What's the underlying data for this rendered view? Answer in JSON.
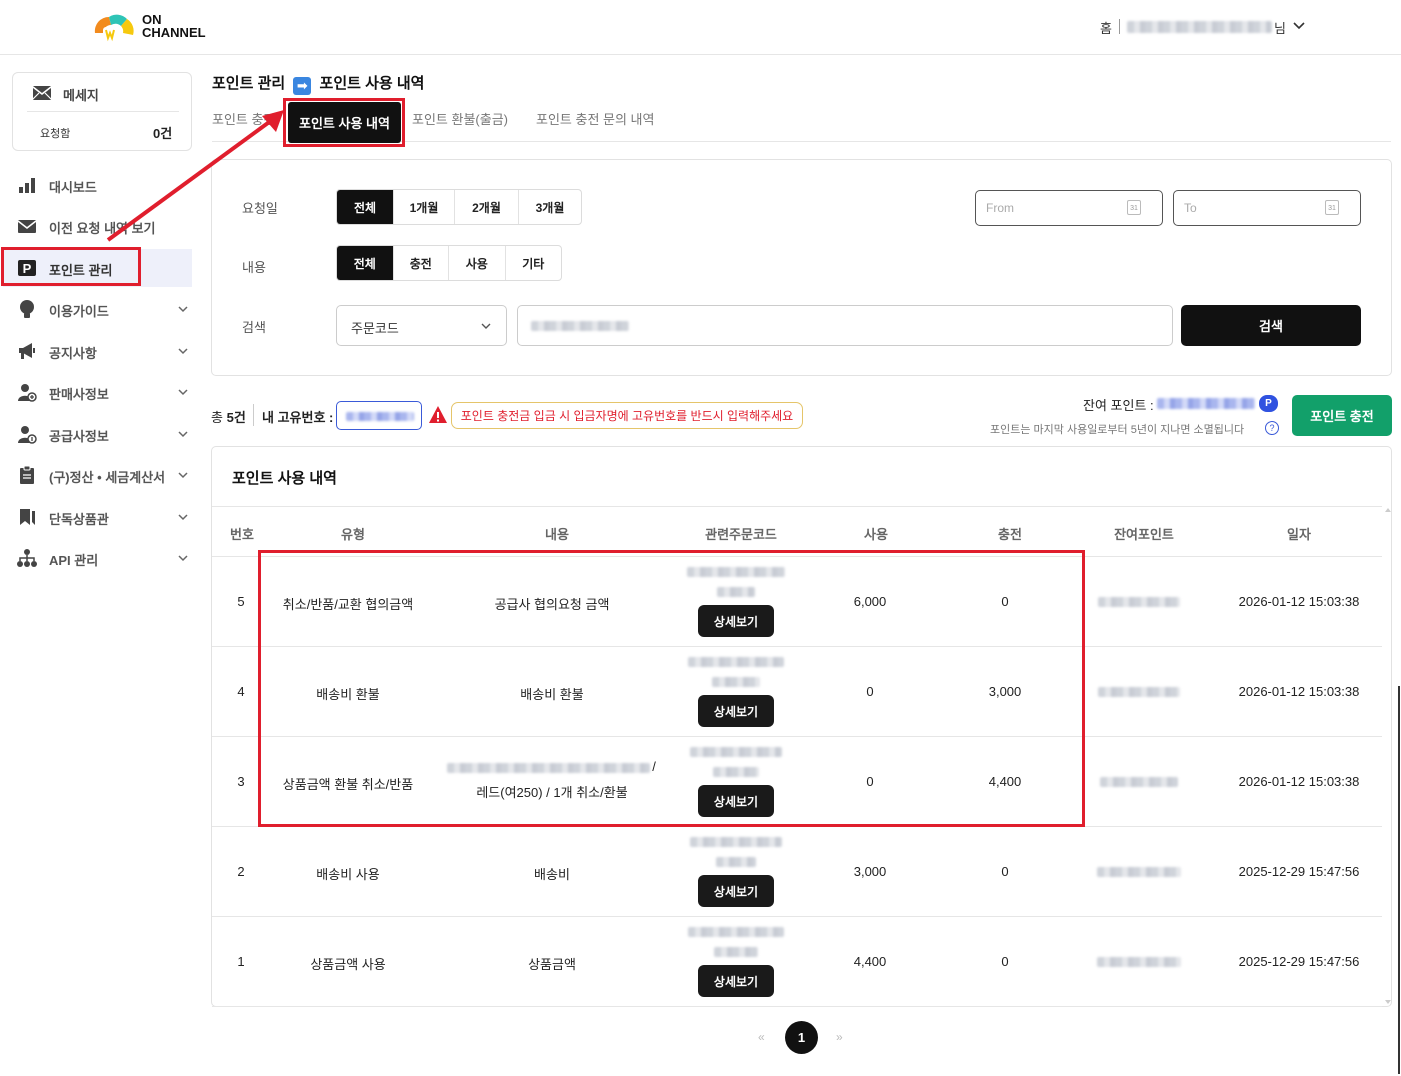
{
  "header": {
    "logo_line1": "ON",
    "logo_line2": "CHANNEL",
    "home_label": "홈",
    "user_suffix": "님"
  },
  "sidebar": {
    "message": {
      "title": "메세지",
      "request_label": "요청함",
      "request_count": "0건"
    },
    "items": [
      {
        "label": "대시보드",
        "icon": "bar-chart-icon",
        "chevron": false
      },
      {
        "label": "이전 요청 내역 보기",
        "icon": "mail-icon",
        "chevron": false
      },
      {
        "label": "포인트 관리",
        "icon": "parking-p-icon",
        "chevron": false,
        "active": true
      },
      {
        "label": "이용가이드",
        "icon": "lightbulb-icon",
        "chevron": true
      },
      {
        "label": "공지사항",
        "icon": "megaphone-icon",
        "chevron": true
      },
      {
        "label": "판매사정보",
        "icon": "user-seller-icon",
        "chevron": true
      },
      {
        "label": "공급사정보",
        "icon": "user-supplier-icon",
        "chevron": true
      },
      {
        "label": "(구)정산 • 세금계산서",
        "icon": "clipboard-icon",
        "chevron": true
      },
      {
        "label": "단독상품관",
        "icon": "bookmark-icon",
        "chevron": true
      },
      {
        "label": "API 관리",
        "icon": "network-icon",
        "chevron": true
      }
    ]
  },
  "breadcrumb": {
    "parent": "포인트 관리",
    "arrow": "➡",
    "current": "포인트 사용 내역"
  },
  "tabs": [
    "포인트 충전",
    "포인트 사용 내역",
    "포인트 환불(출금)",
    "포인트 충전 문의 내역"
  ],
  "filters": {
    "date_label": "요청일",
    "date_options": [
      "전체",
      "1개월",
      "2개월",
      "3개월"
    ],
    "from_placeholder": "From",
    "to_placeholder": "To",
    "calendar_day": "31",
    "content_label": "내용",
    "content_options": [
      "전체",
      "충전",
      "사용",
      "기타"
    ],
    "search_label": "검색",
    "search_type": "주문코드",
    "search_button": "검색"
  },
  "summary": {
    "total_prefix": "총",
    "total_count": "5건",
    "my_id_label": "내 고유번호 :",
    "notice": "포인트 충전금 입금 시 입금자명에 고유번호를 반드시 입력해주세요",
    "remaining_label": "잔여 포인트 :",
    "point_badge": "P",
    "expiry_note": "포인트는 마지막 사용일로부터 5년이 지나면 소멸됩니다",
    "help": "?",
    "charge_button": "포인트 충전"
  },
  "table": {
    "title": "포인트 사용 내역",
    "columns": [
      "번호",
      "유형",
      "내용",
      "관련주문코드",
      "사용",
      "충전",
      "잔여포인트",
      "일자"
    ],
    "detail_label": "상세보기",
    "rows": [
      {
        "no": "5",
        "type": "취소/반품/교환 협의금액",
        "content": "공급사 협의요청 금액",
        "content2": "",
        "used": "6,000",
        "charged": "0",
        "date": "2026-01-12 15:03:38"
      },
      {
        "no": "4",
        "type": "배송비 환불",
        "content": "배송비 환불",
        "content2": "",
        "used": "0",
        "charged": "3,000",
        "date": "2026-01-12 15:03:38"
      },
      {
        "no": "3",
        "type": "상품금액 환불 취소/반품",
        "content": "/",
        "content2": "레드(여250) / 1개 취소/환불",
        "used": "0",
        "charged": "4,400",
        "date": "2026-01-12 15:03:38"
      },
      {
        "no": "2",
        "type": "배송비 사용",
        "content": "배송비",
        "content2": "",
        "used": "3,000",
        "charged": "0",
        "date": "2025-12-29 15:47:56"
      },
      {
        "no": "1",
        "type": "상품금액 사용",
        "content": "상품금액",
        "content2": "",
        "used": "4,400",
        "charged": "0",
        "date": "2025-12-29 15:47:56"
      }
    ]
  },
  "pagination": {
    "prev": "«",
    "current": "1",
    "next": "»"
  },
  "colors": {
    "annotation_red": "#e01e2d",
    "charge_green": "#12a06a",
    "accent_blue": "#3052e0"
  }
}
